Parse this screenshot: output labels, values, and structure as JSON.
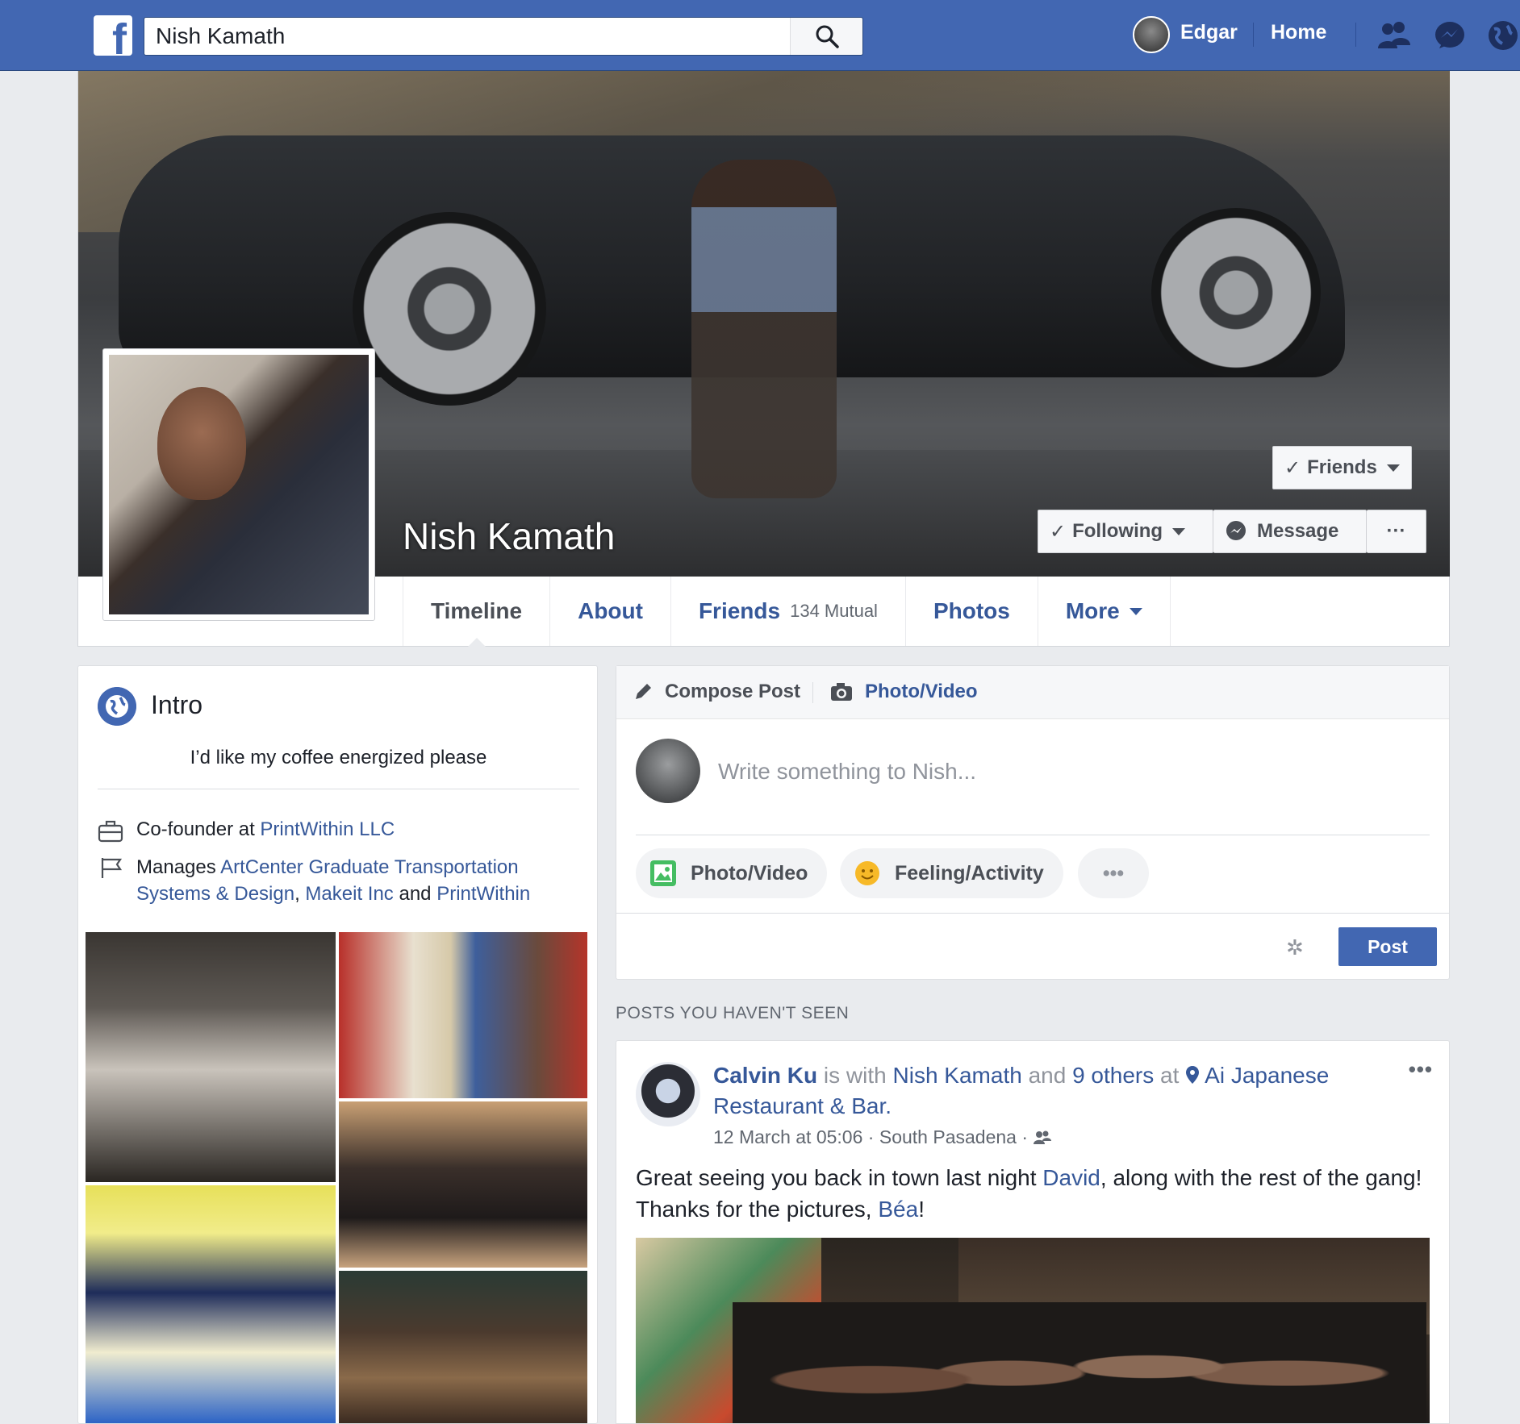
{
  "topbar": {
    "search_value": "Nish Kamath",
    "user_name": "Edgar",
    "home_label": "Home",
    "brand_color": "#4267b2",
    "icons": [
      "friend-requests-icon",
      "messenger-icon",
      "notifications-globe-icon"
    ]
  },
  "profile": {
    "name": "Nish Kamath",
    "friends_button": "Friends",
    "following_button": "Following",
    "message_button": "Message",
    "more_button": "···"
  },
  "tabs": [
    {
      "label": "Timeline",
      "active": true
    },
    {
      "label": "About"
    },
    {
      "label": "Friends",
      "extra": "134 Mutual"
    },
    {
      "label": "Photos"
    },
    {
      "label": "More"
    }
  ],
  "intro": {
    "title": "Intro",
    "bio": "I’d like my coffee energized please",
    "work_prefix": "Co-founder at ",
    "work_company": "PrintWithin LLC",
    "manages_prefix": "Manages ",
    "manages_page_1": "ArtCenter Graduate Transportation Systems & Design",
    "manages_sep": ", ",
    "manages_page_2": "Makeit Inc",
    "manages_and": " and ",
    "manages_page_3": "PrintWithin"
  },
  "composer": {
    "compose_label": "Compose Post",
    "photo_video_tab": "Photo/Video",
    "placeholder": "Write something to Nish...",
    "photo_video_pill": "Photo/Video",
    "feeling_pill": "Feeling/Activity",
    "more_pill": "•••",
    "post_button": "Post"
  },
  "feed": {
    "section_label": "POSTS YOU HAVEN'T SEEN",
    "post": {
      "author": "Calvin Ku",
      "with_text": " is with ",
      "tagged": "Nish Kamath",
      "and_text": " and ",
      "others": "9 others",
      "at_text": " at ",
      "place": "Ai Japanese Restaurant & Bar",
      "period": ".",
      "timestamp": "12 March at 05:06",
      "location": "South Pasadena",
      "meta_sep": " · ",
      "text_1": "Great seeing you back in town last night ",
      "mention_1": "David",
      "text_2": ", along with the rest of the gang! Thanks for the pictures, ",
      "mention_2": "Béa",
      "text_3": "!",
      "more": "•••"
    }
  }
}
